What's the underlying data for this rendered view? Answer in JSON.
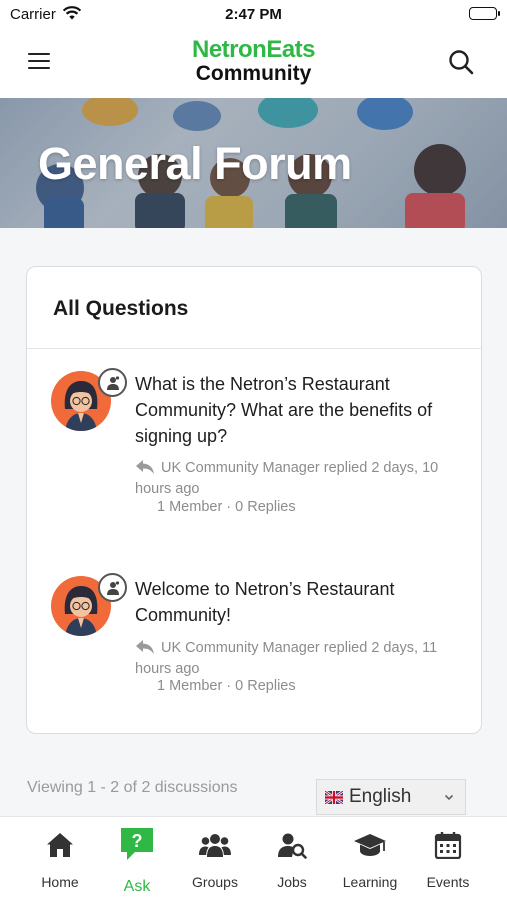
{
  "status_bar": {
    "carrier": "Carrier",
    "time": "2:47 PM"
  },
  "header": {
    "logo_line1": "NetronEats",
    "logo_line2": "Community"
  },
  "banner": {
    "title": "General Forum"
  },
  "card": {
    "title": "All Questions",
    "topics": [
      {
        "title": "What is the Netron’s Restaurant Community? What are the benefits of signing up?",
        "last_reply": "UK Community Manager replied 2 days, 10 hours ago",
        "counts": "1 Member · 0 Replies"
      },
      {
        "title": "Welcome to Netron’s Restaurant Community!",
        "last_reply": "UK Community Manager replied 2 days, 11 hours ago",
        "counts": "1 Member · 0 Replies"
      }
    ]
  },
  "pagination": {
    "text": "Viewing 1 - 2 of 2 discussions"
  },
  "language": {
    "selected": "English",
    "flag_icon": "uk-flag-icon"
  },
  "tabbar": {
    "items": [
      {
        "label": "Home",
        "icon": "home-icon"
      },
      {
        "label": "Ask",
        "icon": "question-icon",
        "active": true
      },
      {
        "label": "Groups",
        "icon": "groups-icon"
      },
      {
        "label": "Jobs",
        "icon": "jobs-icon"
      },
      {
        "label": "Learning",
        "icon": "graduation-cap-icon"
      },
      {
        "label": "Events",
        "icon": "calendar-icon"
      }
    ]
  },
  "colors": {
    "brand_green": "#2fb845",
    "avatar_bg": "#f06a3a",
    "muted_text": "#8c8c8c"
  }
}
